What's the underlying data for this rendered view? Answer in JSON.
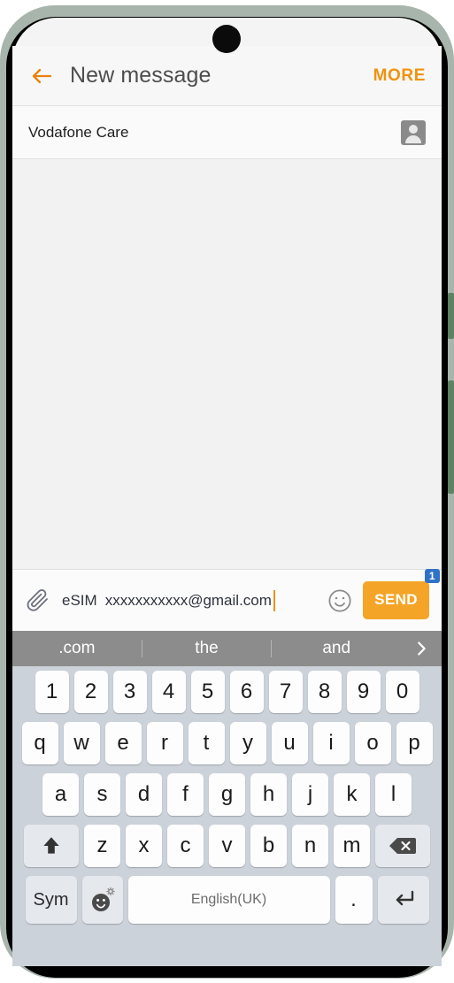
{
  "header": {
    "back_icon": "back-arrow-icon",
    "title": "New message",
    "more_label": "MORE"
  },
  "recipient": {
    "name": "Vodafone Care",
    "contact_picker_icon": "contact-person-icon"
  },
  "compose": {
    "attach_icon": "paperclip-icon",
    "sim_label": "eSIM",
    "message_text": "xxxxxxxxxxx@gmail.com",
    "emoji_icon": "smiley-face-icon",
    "send_label": "SEND",
    "send_badge": "1"
  },
  "keyboard": {
    "suggestions": [
      ".com",
      "the",
      "and"
    ],
    "expand_icon": "chevron-right-icon",
    "row_numbers": [
      "1",
      "2",
      "3",
      "4",
      "5",
      "6",
      "7",
      "8",
      "9",
      "0"
    ],
    "row_top": [
      "q",
      "w",
      "e",
      "r",
      "t",
      "y",
      "u",
      "i",
      "o",
      "p"
    ],
    "row_home": [
      "a",
      "s",
      "d",
      "f",
      "g",
      "h",
      "j",
      "k",
      "l"
    ],
    "row_bottom": [
      "z",
      "x",
      "c",
      "v",
      "b",
      "n",
      "m"
    ],
    "shift_icon": "shift-arrow-icon",
    "backspace_icon": "backspace-icon",
    "sym_label": "Sym",
    "emoji_settings_icon": "emoji-settings-icon",
    "space_label": "English(UK)",
    "period_label": ".",
    "enter_icon": "enter-return-icon"
  },
  "colors": {
    "accent_orange": "#f0920f",
    "send_orange": "#f4a528",
    "badge_blue": "#2f73c7",
    "keyboard_bg": "#ccd2da",
    "suggestion_bg": "#8c8c8c",
    "frame_green": "#5f8265"
  }
}
